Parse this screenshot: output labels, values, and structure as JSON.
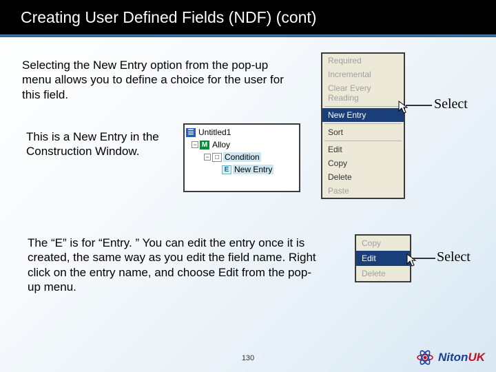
{
  "header": {
    "title": "Creating User Defined Fields (NDF) (cont)"
  },
  "paragraphs": {
    "p1": "Selecting the New Entry option from the pop-up menu allows you to define a choice for the user for this field.",
    "p2": "This is a New Entry in the Construction Window.",
    "p3": "The “E” is for “Entry. ” You can edit the entry once it is created, the same way as you edit the field name. Right click on the entry name, and choose Edit from the pop-up menu."
  },
  "menu1": {
    "items": [
      {
        "label": "Required",
        "state": "disabled"
      },
      {
        "label": "Incremental",
        "state": "disabled"
      },
      {
        "label": "Clear Every Reading",
        "state": "disabled"
      },
      {
        "sep": true
      },
      {
        "label": "New Entry",
        "state": "selected"
      },
      {
        "sep": true
      },
      {
        "label": "Sort",
        "state": "normal"
      },
      {
        "sep": true
      },
      {
        "label": "Edit",
        "state": "normal"
      },
      {
        "label": "Copy",
        "state": "normal"
      },
      {
        "label": "Delete",
        "state": "normal"
      },
      {
        "label": "Paste",
        "state": "disabled"
      }
    ],
    "callout": "Select"
  },
  "tree": {
    "nodes": {
      "root": {
        "icon": "☰",
        "label": "Untitled1"
      },
      "alloy": {
        "icon": "M",
        "label": "Alloy"
      },
      "condition": {
        "icon": "□",
        "label": "Condition"
      },
      "newentry": {
        "icon": "E",
        "label": "New Entry"
      }
    }
  },
  "menu2": {
    "items": [
      {
        "label": "Copy",
        "state": "disabled"
      },
      {
        "label": "Edit",
        "state": "selected"
      },
      {
        "label": "Delete",
        "state": "disabled"
      }
    ],
    "callout": "Select"
  },
  "page_number": "130",
  "brand": {
    "name": "Niton",
    "suffix": "UK"
  }
}
